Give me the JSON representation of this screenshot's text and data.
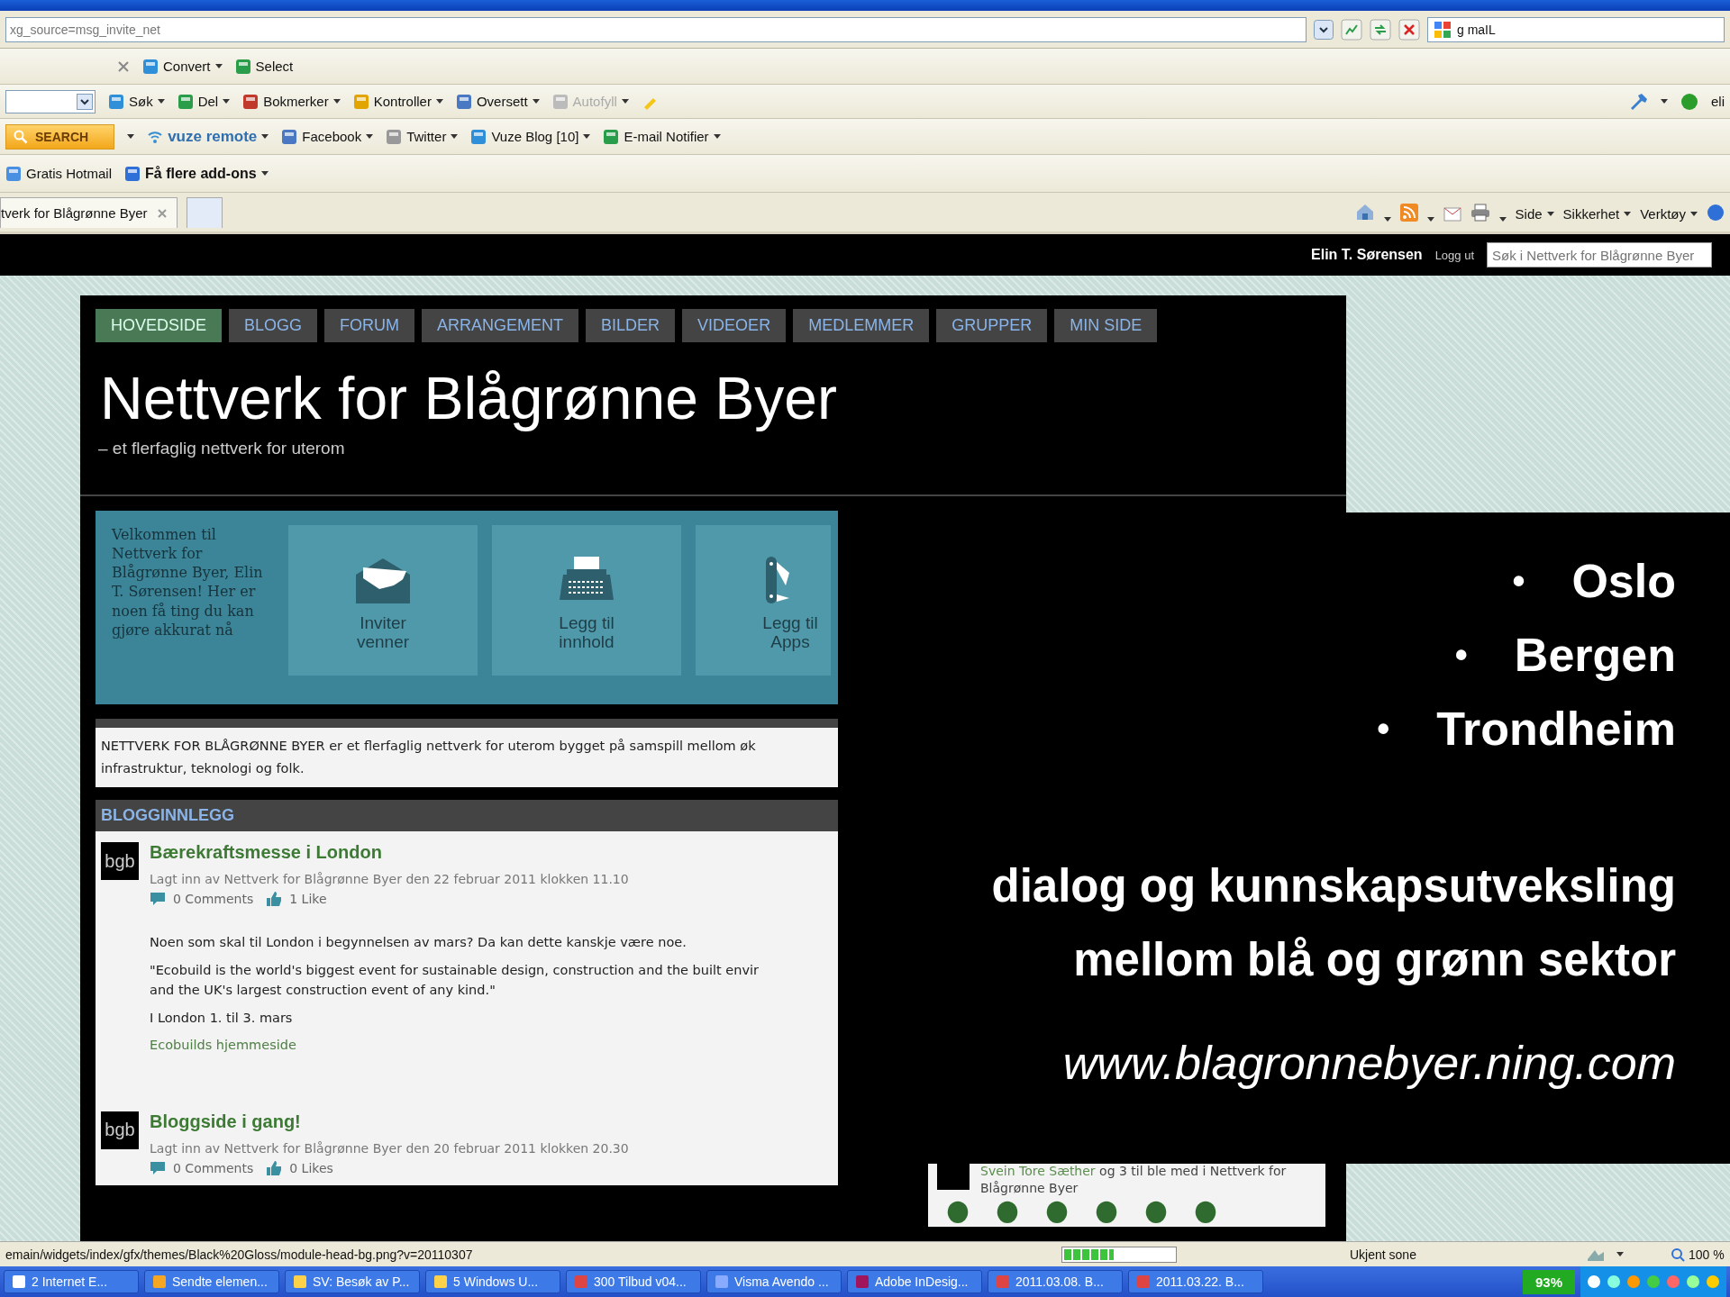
{
  "browser": {
    "address": "xg_source=msg_invite_net",
    "search_value": "g maIL",
    "toolbar_1": [
      {
        "label": "Convert",
        "kind": "menu"
      },
      {
        "label": "Select",
        "kind": "plain"
      }
    ],
    "toolbar_2": [
      {
        "label": "Søk",
        "kind": "menu",
        "disabled": false
      },
      {
        "label": "Del",
        "kind": "menu",
        "disabled": false
      },
      {
        "label": "Bokmerker",
        "kind": "menu",
        "disabled": false
      },
      {
        "label": "Kontroller",
        "kind": "menu",
        "disabled": false
      },
      {
        "label": "Oversett",
        "kind": "menu",
        "disabled": false
      },
      {
        "label": "Autofyll",
        "kind": "menu",
        "disabled": true
      }
    ],
    "toolbar_2_right": "eli",
    "toolbar_3": [
      {
        "label": "SEARCH",
        "kind": "search"
      },
      {
        "label": "vuze remote",
        "kind": "brand"
      },
      {
        "label": "Facebook",
        "kind": "menu"
      },
      {
        "label": "Twitter",
        "kind": "menu"
      },
      {
        "label": "Vuze Blog  [10]",
        "kind": "menu"
      },
      {
        "label": "E-mail Notifier",
        "kind": "menu"
      }
    ],
    "favorites": [
      {
        "label": "Gratis Hotmail",
        "kind": "link"
      },
      {
        "label": "Få flere add-ons",
        "kind": "menu"
      }
    ],
    "tabs": [
      {
        "label": "tverk for Blågrønne Byer",
        "selected": true
      },
      {
        "selected": false
      }
    ],
    "command_bar": [
      "Side",
      "Sikkerhet",
      "Verktøy"
    ]
  },
  "site_bar": {
    "user": "Elin T. Sørensen",
    "logout": "Logg ut",
    "search_placeholder": "Søk i Nettverk for Blågrønne Byer"
  },
  "nav": [
    {
      "label": "HOVEDSIDE",
      "selected": true
    },
    {
      "label": "BLOGG",
      "selected": false
    },
    {
      "label": "FORUM",
      "selected": false
    },
    {
      "label": "ARRANGEMENT",
      "selected": false
    },
    {
      "label": "BILDER",
      "selected": false
    },
    {
      "label": "VIDEOER",
      "selected": false
    },
    {
      "label": "MEDLEMMER",
      "selected": false
    },
    {
      "label": "GRUPPER",
      "selected": false
    },
    {
      "label": "MIN SIDE",
      "selected": false
    }
  ],
  "site_title": "Nettverk for Blågrønne Byer",
  "site_subtitle": "– et flerfaglig nettverk for uterom",
  "welcome": {
    "text": "Velkommen til Nettverk for Blågrønne Byer, Elin T. Sørensen! Her er noen få ting du kan gjøre akkurat nå",
    "tiles": [
      {
        "kind": "invite",
        "label": "Inviter venner"
      },
      {
        "kind": "content",
        "label": "Legg til innhold"
      },
      {
        "kind": "apps",
        "label": "Legg til Apps"
      }
    ]
  },
  "description": {
    "lines": [
      "NETTVERK FOR BLÅGRØNNE BYER er et flerfaglig nettverk for uterom bygget på samspill mellom øk",
      "infrastruktur, teknologi og folk."
    ]
  },
  "blog": {
    "heading": "BLOGGINNLEGG",
    "posts": [
      {
        "avatar": "bgb",
        "title": "Bærekraftsmesse i London",
        "meta": "Lagt inn av Nettverk for Blågrønne Byer den 22 februar 2011 klokken 11.10",
        "comments": "0 Comments",
        "likes": "1 Like",
        "body": [
          {
            "kind": "text",
            "lines": [
              "Noen som skal til London i begynnelsen av mars? Da kan dette kanskje være noe."
            ]
          },
          {
            "kind": "text",
            "lines": [
              "\"Ecobuild is the world's biggest event for sustainable design, construction and the built envir",
              "and the UK's largest construction event of any kind.\""
            ]
          },
          {
            "kind": "text",
            "lines": [
              "I London 1. til 3. mars"
            ]
          },
          {
            "kind": "link",
            "lines": [
              "Ecobuilds hjemmeside"
            ]
          }
        ]
      },
      {
        "avatar": "bgb",
        "title": "Bloggside i gang!",
        "meta": "Lagt inn av Nettverk for Blågrønne Byer den 20 februar 2011 klokken 20.30",
        "comments": "0 Comments",
        "likes": "0 Likes"
      }
    ]
  },
  "sidebar": {
    "member_name": "Svein Tore Sæther",
    "activity": " og 3 til ble med i Nettverk for Blågrønne Byer"
  },
  "overlay": {
    "cities": [
      {
        "bullet": "•",
        "name": "Oslo"
      },
      {
        "bullet": "•",
        "name": "Bergen"
      },
      {
        "bullet": "•",
        "name": "Trondheim"
      }
    ],
    "tagline": [
      "dialog og kunnskapsutveksling",
      "mellom blå og grønn sektor"
    ],
    "url": "www.blagronnebyer.ning.com"
  },
  "status_bar": {
    "url": "emain/widgets/index/gfx/themes/Black%20Gloss/module-head-bg.png?v=20110307",
    "level": 0.45,
    "zone": "Ukjent sone",
    "zoom": "100 %"
  },
  "taskbar": {
    "items": [
      "2 Internet E...",
      "Sendte elemen...",
      "SV: Besøk av P...",
      "5 Windows U...",
      "300 Tilbud v04...",
      "Visma Avendo ...",
      "Adobe InDesig...",
      "2011.03.08. B...",
      "2011.03.22. B..."
    ],
    "battery": "93%"
  }
}
